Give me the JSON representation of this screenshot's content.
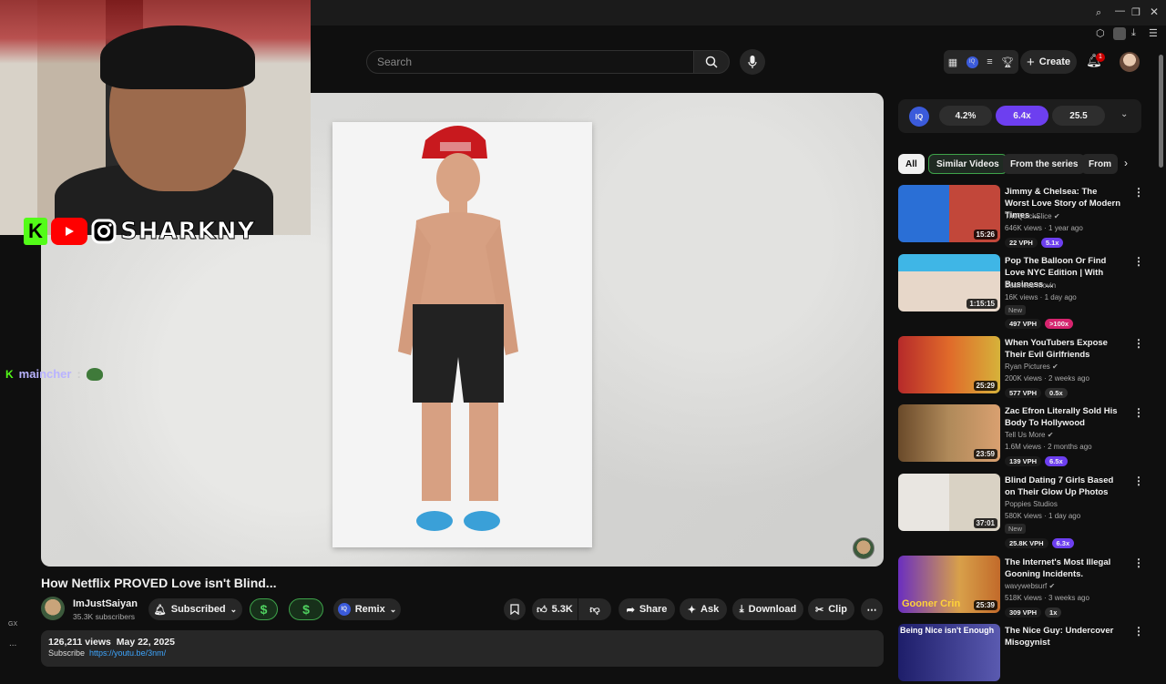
{
  "header": {
    "search_placeholder": "Search",
    "create_label": "Create",
    "notification_count": "1",
    "ext_iq": "IQ"
  },
  "overlay": {
    "handle": "SHARKNY",
    "chat_user": "maincher"
  },
  "video": {
    "title": "How Netflix PROVED Love isn't Blind...",
    "channel": "ImJustSaiyan",
    "subscribers": "35.3K subscribers",
    "subscribed_label": "Subscribed",
    "dollar": "$",
    "remix_label": "Remix",
    "likes": "5.3K",
    "share_label": "Share",
    "ask_label": "Ask",
    "download_label": "Download",
    "clip_label": "Clip",
    "views": "126,211 views",
    "date": "May 22, 2025",
    "desc_prefix": "Subscribe",
    "desc_link": "https://youtu.be/3nm/"
  },
  "left_rail": {
    "label_1": "GX",
    "label_2": "..."
  },
  "metrics": {
    "iq": "IQ",
    "m1": "4.2%",
    "m2": "6.4x",
    "m3": "25.5"
  },
  "chips": [
    "All",
    "Similar Videos",
    "From the series",
    "From"
  ],
  "related": [
    {
      "title": "Jimmy & Chelsea: The Worst Love Story of Modern Times ...",
      "channel": "TheQuickSlice",
      "meta": "646K views · 1 year ago",
      "duration": "15:26",
      "vph": "22 VPH",
      "mult": "5.1x",
      "is_new": false
    },
    {
      "title": "Pop The Balloon Or Find Love NYC Edition | With Business ...",
      "channel": "Business Movin",
      "meta": "16K views · 1 day ago",
      "duration": "1:15:15",
      "vph": "497 VPH",
      "mult": ">100x",
      "is_new": true,
      "new_label": "New"
    },
    {
      "title": "When YouTubers Expose Their Evil Girlfriends",
      "channel": "Ryan Pictures",
      "meta": "200K views · 2 weeks ago",
      "duration": "25:29",
      "vph": "577 VPH",
      "mult": "0.5x",
      "is_new": false
    },
    {
      "title": "Zac Efron Literally Sold His Body To Hollywood",
      "channel": "Tell Us More",
      "meta": "1.6M views · 2 months ago",
      "duration": "23:59",
      "vph": "139 VPH",
      "mult": "6.5x",
      "is_new": false
    },
    {
      "title": "Blind Dating 7 Girls Based on Their Glow Up Photos",
      "channel": "Poppies Studios",
      "meta": "580K views · 1 day ago",
      "duration": "37:01",
      "vph": "25.8K VPH",
      "mult": "6.3x",
      "is_new": true,
      "new_label": "New"
    },
    {
      "title": "The Internet's Most Illegal Gooning Incidents.",
      "channel": "wavywebsurf",
      "meta": "518K views · 3 weeks ago",
      "duration": "25:39",
      "vph": "309 VPH",
      "mult": "1x",
      "is_new": false,
      "thumb_text": "Gooner Crin"
    },
    {
      "title": "The Nice Guy: Undercover Misogynist",
      "channel": "",
      "meta": "",
      "duration": "",
      "vph": "",
      "mult": "",
      "is_new": false,
      "thumb_text": "Being Nice isn't Enough"
    }
  ]
}
